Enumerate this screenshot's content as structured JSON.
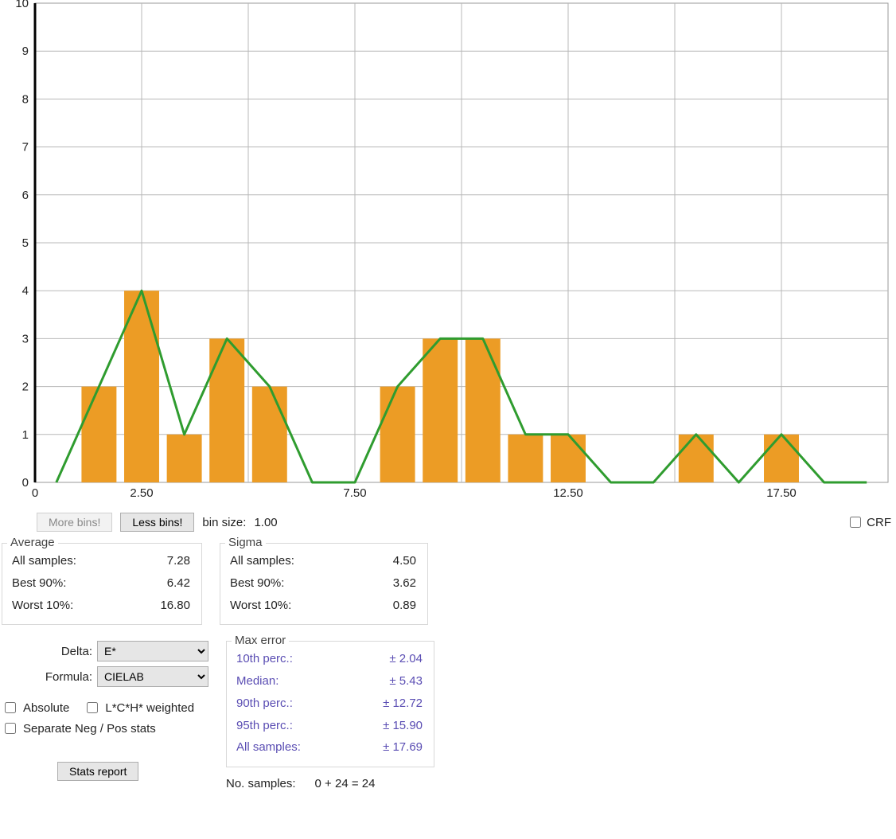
{
  "chart_data": {
    "type": "bar",
    "categories": [
      0.5,
      1.5,
      2.5,
      3.5,
      4.5,
      5.5,
      6.5,
      7.5,
      8.5,
      9.5,
      10.5,
      11.5,
      12.5,
      13.5,
      14.5,
      15.5,
      16.5,
      17.5,
      18.5,
      19.5
    ],
    "values": [
      0,
      2,
      4,
      1,
      3,
      2,
      0,
      0,
      2,
      3,
      3,
      1,
      1,
      0,
      0,
      1,
      0,
      1,
      0,
      0
    ],
    "overlay_line": true,
    "x_ticks": [
      "0",
      "2.50",
      "7.50",
      "12.50",
      "17.50"
    ],
    "x_tick_values": [
      0,
      2.5,
      7.5,
      12.5,
      17.5
    ],
    "y_ticks": [
      0,
      1,
      2,
      3,
      4,
      5,
      6,
      7,
      8,
      9,
      10
    ],
    "xlim": [
      0,
      20
    ],
    "ylim": [
      0,
      10
    ],
    "bar_color": "#ec9c25",
    "line_color": "#2f9c2f",
    "grid": true
  },
  "buttons": {
    "more_bins": "More bins!",
    "less_bins": "Less bins!",
    "stats_report": "Stats report"
  },
  "bin_size_label": "bin size:",
  "bin_size_value": "1.00",
  "crf_label": "CRF",
  "average": {
    "title": "Average",
    "all_label": "All samples:",
    "all_value": "7.28",
    "best_label": "Best 90%:",
    "best_value": "6.42",
    "worst_label": "Worst 10%:",
    "worst_value": "16.80"
  },
  "sigma": {
    "title": "Sigma",
    "all_label": "All samples:",
    "all_value": "4.50",
    "best_label": "Best 90%:",
    "best_value": "3.62",
    "worst_label": "Worst 10%:",
    "worst_value": "0.89"
  },
  "selects": {
    "delta_label": "Delta:",
    "delta_value": "E*",
    "formula_label": "Formula:",
    "formula_value": "CIELAB"
  },
  "checkboxes": {
    "absolute": "Absolute",
    "lch_weighted": "L*C*H* weighted",
    "sep_negpos": "Separate Neg / Pos stats"
  },
  "max_error": {
    "title": "Max error",
    "p10_label": "10th perc.:",
    "p10_value": "± 2.04",
    "median_label": "Median:",
    "median_value": "± 5.43",
    "p90_label": "90th perc.:",
    "p90_value": "± 12.72",
    "p95_label": "95th perc.:",
    "p95_value": "± 15.90",
    "all_label": "All samples:",
    "all_value": "± 17.69"
  },
  "nsamples_label": "No. samples:",
  "nsamples_value": "0 + 24 = 24"
}
